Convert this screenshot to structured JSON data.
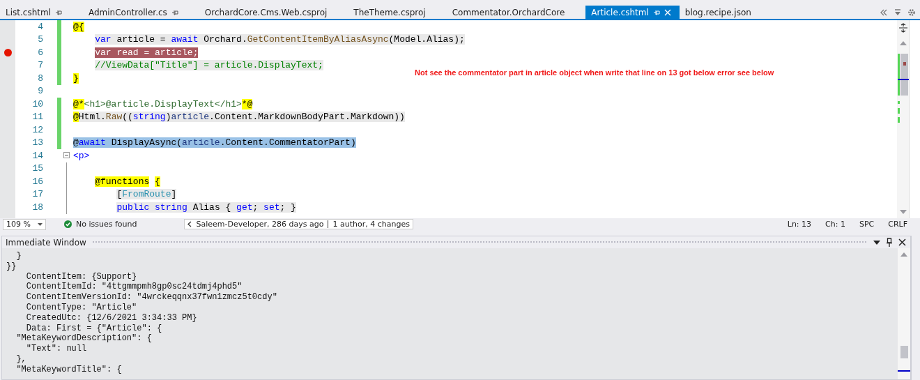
{
  "tabs": [
    {
      "label": "List.cshtml",
      "pinned": true,
      "selected": false,
      "closable": false
    },
    {
      "label": "AdminController.cs",
      "pinned": true,
      "selected": false,
      "closable": false
    },
    {
      "label": "OrchardCore.Cms.Web.csproj",
      "pinned": false,
      "selected": false,
      "closable": false
    },
    {
      "label": "TheTheme.csproj",
      "pinned": false,
      "selected": false,
      "closable": false
    },
    {
      "label": "Commentator.OrchardCore",
      "pinned": false,
      "selected": false,
      "closable": false
    },
    {
      "label": "Article.cshtml",
      "pinned": true,
      "selected": true,
      "closable": true
    },
    {
      "label": "blog.recipe.json",
      "pinned": false,
      "selected": false,
      "closable": false
    }
  ],
  "editor": {
    "lines": [
      {
        "number": "4",
        "changed": true,
        "breakpoint": false,
        "tokens": [
          {
            "text": "@{",
            "kind": "razor"
          }
        ]
      },
      {
        "number": "5",
        "changed": true,
        "breakpoint": false,
        "shaded": true,
        "tokens": [
          {
            "text": "    var",
            "kind": "keyword"
          },
          {
            "text": " article = ",
            "kind": "plain"
          },
          {
            "text": "await",
            "kind": "keyword"
          },
          {
            "text": " Orchard.",
            "kind": "plain"
          },
          {
            "text": "GetContentItemByAliasAsync",
            "kind": "method"
          },
          {
            "text": "(Model.Alias);",
            "kind": "plain"
          }
        ]
      },
      {
        "number": "6",
        "changed": true,
        "breakpoint": true,
        "tokens": [
          {
            "text": "    var read = article;",
            "kind": "plain"
          }
        ]
      },
      {
        "number": "7",
        "changed": true,
        "breakpoint": false,
        "shaded": true,
        "tokens": [
          {
            "text": "    //ViewData[\"Title\"] = article.DisplayText;",
            "kind": "comment"
          }
        ]
      },
      {
        "number": "8",
        "changed": true,
        "breakpoint": false,
        "tokens": [
          {
            "text": "}",
            "kind": "razor"
          }
        ]
      },
      {
        "number": "9",
        "changed": false,
        "breakpoint": false
      },
      {
        "number": "10",
        "changed": true,
        "breakpoint": false,
        "tokens": [
          {
            "text": "@*",
            "kind": "razor"
          },
          {
            "text": "<h1>@article.DisplayText</h1>",
            "kind": "razorcomment"
          },
          {
            "text": "*@",
            "kind": "razor"
          }
        ]
      },
      {
        "number": "11",
        "changed": true,
        "breakpoint": false,
        "tokens": [
          {
            "text": "@",
            "kind": "razor"
          },
          {
            "text": "Html.",
            "kind": "plainshaded"
          },
          {
            "text": "Raw",
            "kind": "methodshaded"
          },
          {
            "text": "((",
            "kind": "plainshaded"
          },
          {
            "text": "string",
            "kind": "keywordshaded"
          },
          {
            "text": ")",
            "kind": "plainshaded"
          },
          {
            "text": "article",
            "kind": "variableshaded"
          },
          {
            "text": ".Content.MarkdownBodyPart.Markdown))",
            "kind": "plainshaded"
          }
        ]
      },
      {
        "number": "12",
        "changed": true,
        "breakpoint": false
      },
      {
        "number": "13",
        "changed": true,
        "breakpoint": false,
        "highlighted": true,
        "tokens": [
          {
            "text": "@",
            "kind": "razor"
          },
          {
            "text": "await",
            "kind": "keyword"
          },
          {
            "text": " DisplayAsync(",
            "kind": "plain"
          },
          {
            "text": "article",
            "kind": "variable"
          },
          {
            "text": ".Content.CommentatorPart)",
            "kind": "plain"
          }
        ]
      },
      {
        "number": "14",
        "changed": false,
        "breakpoint": false,
        "expanded": true,
        "tokens": [
          {
            "text": "<p>",
            "kind": "tag"
          }
        ]
      },
      {
        "number": "15",
        "changed": false,
        "breakpoint": false,
        "in_region": true
      },
      {
        "number": "16",
        "changed": false,
        "breakpoint": false,
        "in_region": true,
        "tokens": [
          {
            "text": "    @functions",
            "kind": "razor"
          },
          {
            "text": " {",
            "kind": "razor"
          }
        ]
      },
      {
        "number": "17",
        "changed": false,
        "breakpoint": false,
        "shaded": true,
        "in_region": true,
        "tokens": [
          {
            "text": "        [",
            "kind": "plain"
          },
          {
            "text": "FromRoute",
            "kind": "type"
          },
          {
            "text": "]",
            "kind": "plain"
          }
        ]
      },
      {
        "number": "18",
        "changed": false,
        "breakpoint": false,
        "shaded": true,
        "in_region": true,
        "tokens": [
          {
            "text": "        public",
            "kind": "keyword"
          },
          {
            "text": " string",
            "kind": "keyword"
          },
          {
            "text": " Alias { ",
            "kind": "plain"
          },
          {
            "text": "get",
            "kind": "keyword"
          },
          {
            "text": "; ",
            "kind": "plain"
          },
          {
            "text": "set",
            "kind": "keyword"
          },
          {
            "text": "; }",
            "kind": "plain"
          }
        ]
      }
    ],
    "annotation": "Not see the commentator part in article object when write that line on 13 got below error see below"
  },
  "status_bar": {
    "zoom": "109 %",
    "issues": "No issues found",
    "blame_author": "Saleem-Developer, 286 days ago",
    "blame_changes": "1 author, 4 changes",
    "line": "Ln: 13",
    "column": "Ch: 1",
    "indentation": "SPC",
    "line_ending": "CRLF"
  },
  "immediate": {
    "title": "Immediate Window",
    "lines": [
      "  }",
      "}}",
      "    ContentItem: {Support}",
      "    ContentItemId: \"4ttgmmpmh8gp0sc24tdmj4phd5\"",
      "    ContentItemVersionId: \"4wrckeqqnx37fwn1zmcz5t0cdy\"",
      "    ContentType: \"Article\"",
      "    CreatedUtc: {12/6/2021 3:34:33 PM}",
      "    Data: First = {\"Article\": {",
      "  \"MetaKeywordDescription\": {",
      "    \"Text\": null",
      "  },",
      "  \"MetaKeywordTitle\": {"
    ]
  }
}
